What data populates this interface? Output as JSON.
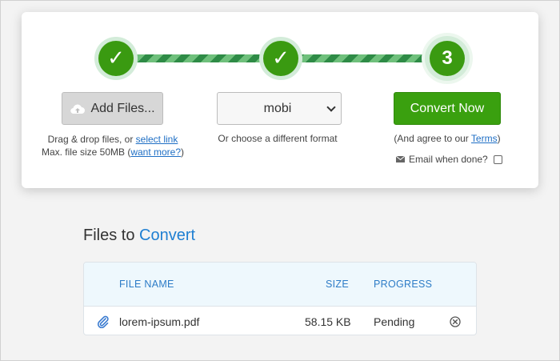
{
  "steps": [
    {
      "state": "done",
      "glyph": "✓"
    },
    {
      "state": "done",
      "glyph": "✓"
    },
    {
      "state": "current",
      "label": "3"
    }
  ],
  "upload": {
    "button_label": "Add Files...",
    "icon": "cloud-upload-icon",
    "hint_prefix": "Drag & drop files, or ",
    "hint_link": "select link",
    "max_prefix": "Max. file size 50MB (",
    "max_link": "want more?",
    "max_suffix": ")"
  },
  "format": {
    "selected": "mobi",
    "hint": "Or choose a different format"
  },
  "convert": {
    "button_label": "Convert Now",
    "terms_prefix": "(And agree to our ",
    "terms_link": "Terms",
    "terms_suffix": ")",
    "email_label": "Email when done?",
    "email_checked": false
  },
  "files_section": {
    "title_plain": "Files to ",
    "title_accent": "Convert"
  },
  "table": {
    "headers": {
      "name": "FILE NAME",
      "size": "SIZE",
      "progress": "PROGRESS"
    },
    "rows": [
      {
        "name": "lorem-ipsum.pdf",
        "size": "58.15 KB",
        "progress": "Pending"
      }
    ]
  },
  "colors": {
    "accent_green": "#3aa00f",
    "link_blue": "#1f6fc5",
    "header_blue": "#2d7cc7"
  }
}
